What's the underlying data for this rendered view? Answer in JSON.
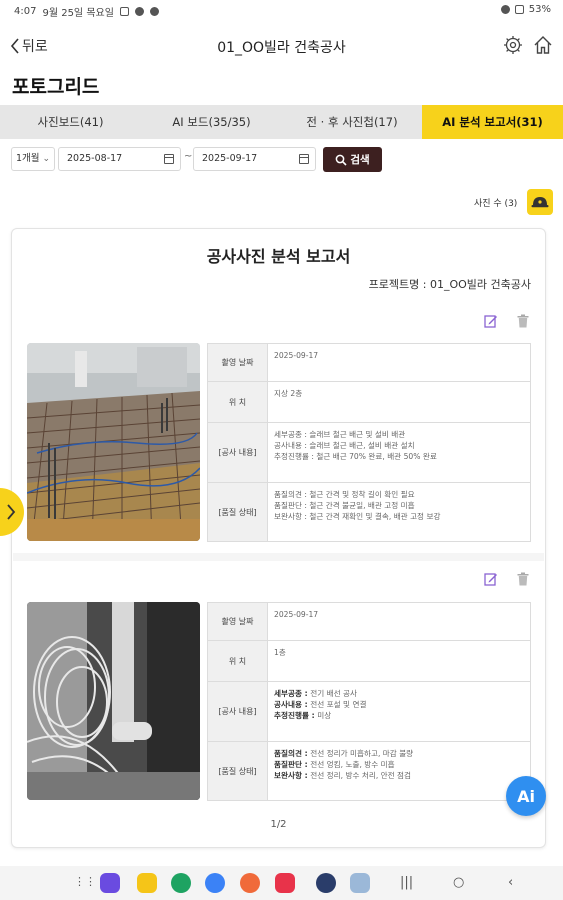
{
  "status_bar": {
    "time": "4:07",
    "date": "9월 25일 목요일",
    "battery": "53%"
  },
  "nav": {
    "back_label": "뒤로",
    "title": "01_OO빌라 건축공사"
  },
  "page_title": "포토그리드",
  "tabs": [
    {
      "label": "사진보드(41)",
      "active": false
    },
    {
      "label": "AI 보드(35/35)",
      "active": false
    },
    {
      "label": "전 · 후 사진첩(17)",
      "active": false
    },
    {
      "label": "AI 분석 보고서(31)",
      "active": true
    }
  ],
  "filters": {
    "period": "1개월",
    "start_date": "2025-08-17",
    "separator": "~",
    "end_date": "2025-09-17",
    "search_label": "검색"
  },
  "photo_count": "사진 수 (3)",
  "report": {
    "title": "공사사진 분석 보고서",
    "project_label": "프로젝트명 : ",
    "project_name": "01_OO빌라 건축공사",
    "entries": [
      {
        "rows": [
          {
            "key": "촬영 날짜",
            "lines": [
              "2025-09-17"
            ]
          },
          {
            "key": "위    치",
            "lines": [
              "지상 2층"
            ]
          },
          {
            "key": "[공사 내용]",
            "lines": [
              {
                "k": "세부공종 : ",
                "v": "슬래브 철근 배근 및 설비 배관"
              },
              {
                "k": "공사내용 : ",
                "v": "슬래브 철근 배근, 설비 배관 설치"
              },
              {
                "k": "추정진행률 : ",
                "v": "철근 배근 70% 완료, 배관 50% 완료"
              }
            ]
          },
          {
            "key": "[품질 상태]",
            "lines": [
              {
                "k": "품질의견 : ",
                "v": "철근 간격 및 정착 길이 확인 필요"
              },
              {
                "k": "품질판단 : ",
                "v": "철근 간격 불균일, 배관 고정 미흡"
              },
              {
                "k": "보완사항 : ",
                "v": "철근 간격 재확인 및 결속, 배관 고정 보강"
              }
            ]
          }
        ]
      },
      {
        "rows": [
          {
            "key": "촬영 날짜",
            "lines": [
              "2025-09-17"
            ]
          },
          {
            "key": "위    치",
            "lines": [
              "1층"
            ]
          },
          {
            "key": "[공사 내용]",
            "lines": [
              {
                "k": "세부공종 : ",
                "v": "전기 배선 공사"
              },
              {
                "k": "공사내용 : ",
                "v": "전선 포설 및 연결"
              },
              {
                "k": "추정진행률 : ",
                "v": "미상"
              }
            ]
          },
          {
            "key": "[품질 상태]",
            "lines": [
              {
                "k": "품질의견 : ",
                "v": "전선 정리가 미흡하고, 마감 불량"
              },
              {
                "k": "품질판단 : ",
                "v": "전선 엉킴, 노출, 방수 미흡"
              },
              {
                "k": "보완사항 : ",
                "v": "전선 정리, 방수 처리, 안전 점검"
              }
            ]
          }
        ]
      }
    ],
    "pager": "1/2"
  },
  "ai_fab_label": "Ai",
  "colors": {
    "accent": "#f7d21b",
    "search_button": "#3d2020",
    "ai_fab": "#2f8ff0",
    "tab_bar": "#e6e6e6"
  },
  "icons": [
    "chevron-left-icon",
    "gear-icon",
    "home-icon",
    "search-icon",
    "calendar-icon",
    "edit-icon",
    "trash-icon",
    "chevron-right-icon",
    "hardhat-icon"
  ]
}
